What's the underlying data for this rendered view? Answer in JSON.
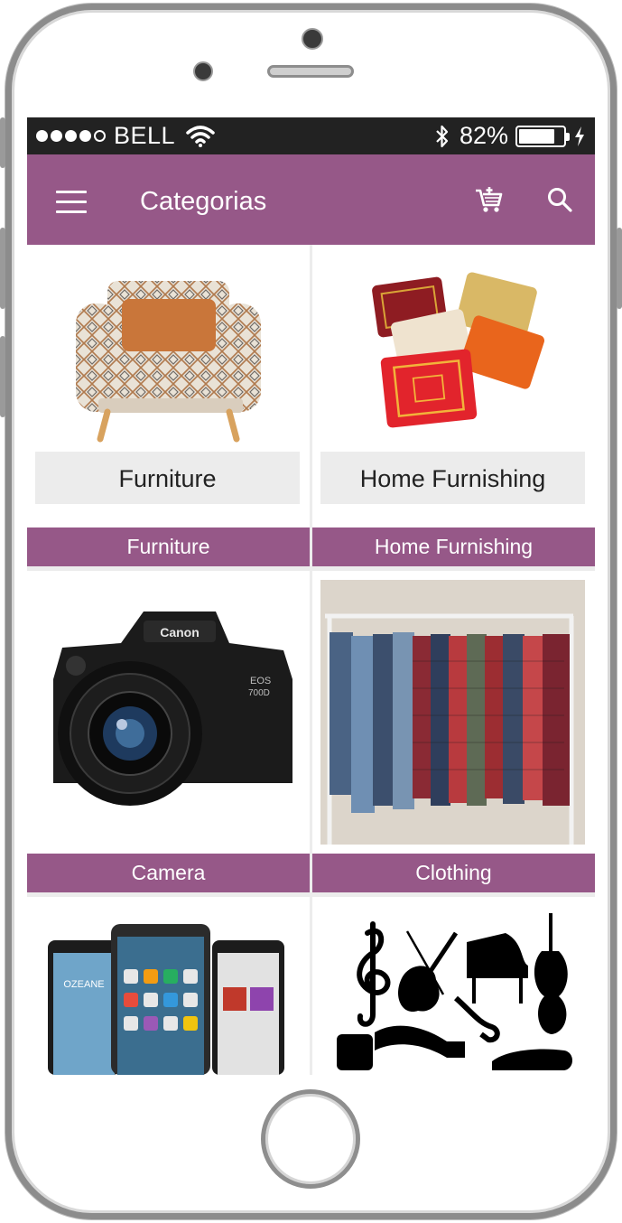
{
  "status_bar": {
    "carrier": "BELL",
    "battery_percent": "82%",
    "battery_level": 0.82
  },
  "app_bar": {
    "title": "Categorias",
    "menu_icon": "hamburger-menu-icon",
    "cart_icon": "shopping-cart-icon",
    "search_icon": "search-icon"
  },
  "categories": [
    {
      "caption": "Furniture",
      "image_label": "Furniture",
      "image": "armchair"
    },
    {
      "caption": "Home Furnishing",
      "image_label": "Home Furnishing",
      "image": "cushions"
    },
    {
      "caption": "Camera",
      "image": "dslr-camera"
    },
    {
      "caption": "Clothing",
      "image": "clothes-rack"
    },
    {
      "caption": "",
      "image": "smartphones"
    },
    {
      "caption": "",
      "image": "musical-instruments"
    }
  ],
  "colors": {
    "accent": "#965888",
    "status_bar": "#222222",
    "grid_background": "#ececec"
  }
}
